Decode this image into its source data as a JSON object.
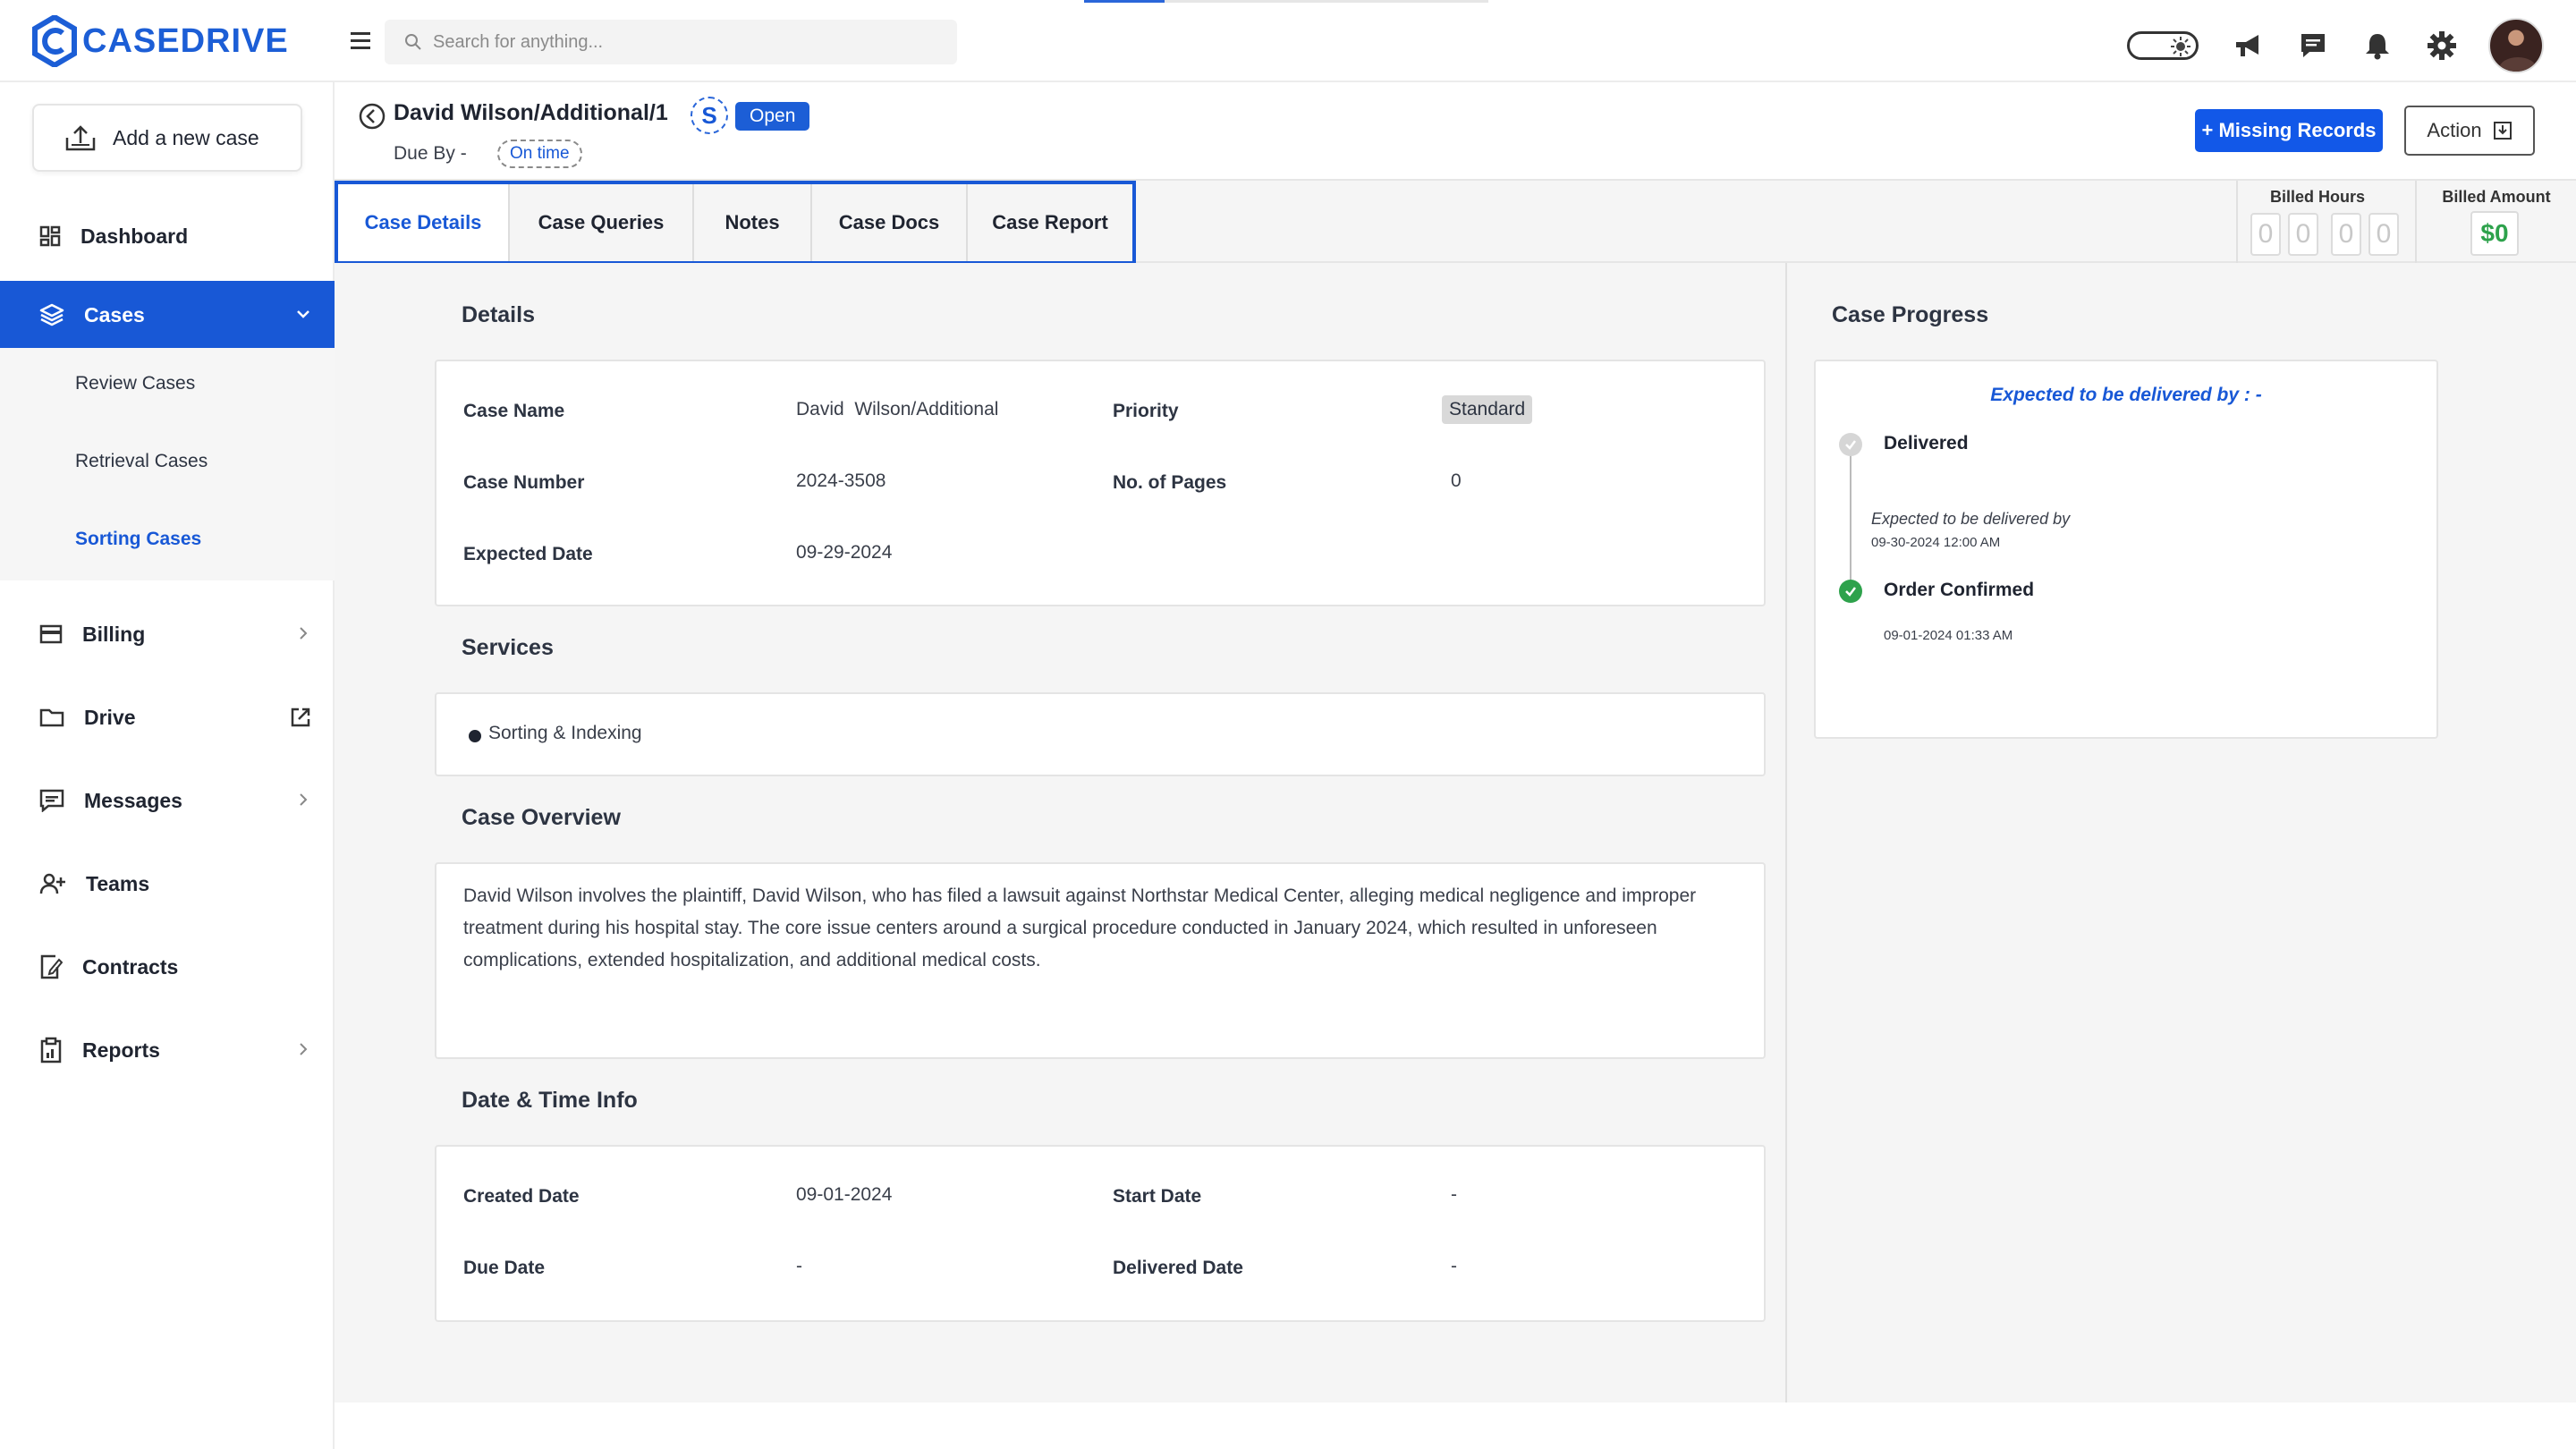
{
  "app": {
    "logo_text": "CASEDRIVE"
  },
  "search": {
    "placeholder": "Search for anything..."
  },
  "sidebar": {
    "add_case_label": "Add a new case",
    "items": [
      {
        "label": "Dashboard",
        "icon": "dashboard-icon"
      },
      {
        "label": "Cases",
        "icon": "layers-icon",
        "active": true
      },
      {
        "label": "Billing",
        "icon": "card-icon"
      },
      {
        "label": "Drive",
        "icon": "folder-icon"
      },
      {
        "label": "Messages",
        "icon": "message-icon"
      },
      {
        "label": "Teams",
        "icon": "users-icon"
      },
      {
        "label": "Contracts",
        "icon": "contract-icon"
      },
      {
        "label": "Reports",
        "icon": "report-icon"
      }
    ],
    "cases_sub": [
      "Review Cases",
      "Retrieval Cases",
      "Sorting Cases"
    ],
    "active_sub": "Sorting Cases"
  },
  "header": {
    "case_title": "David Wilson/Additional/1",
    "service_badge": "S",
    "status": "Open",
    "due_by_label": "Due By -",
    "due_status": "On time",
    "missing_records_label": "+ Missing Records",
    "action_label": "Action"
  },
  "tabs": [
    "Case Details",
    "Case Queries",
    "Notes",
    "Case Docs",
    "Case Report"
  ],
  "active_tab": "Case Details",
  "billing": {
    "hours_label": "Billed Hours",
    "hours_digits": [
      "0",
      "0",
      "0",
      "0"
    ],
    "amount_label": "Billed Amount",
    "amount": "$0"
  },
  "details": {
    "title": "Details",
    "case_name_label": "Case Name",
    "case_name": "David  Wilson/Additional",
    "priority_label": "Priority",
    "priority": "Standard",
    "case_number_label": "Case Number",
    "case_number": "2024-3508",
    "pages_label": "No. of Pages",
    "pages": "0",
    "expected_date_label": "Expected Date",
    "expected_date": "09-29-2024"
  },
  "services": {
    "title": "Services",
    "items": [
      "Sorting & Indexing"
    ]
  },
  "overview": {
    "title": "Case Overview",
    "text": "David Wilson involves the plaintiff, David Wilson, who has filed a lawsuit against Northstar Medical Center, alleging medical negligence and improper treatment during his hospital stay. The core issue centers around a surgical procedure conducted in January 2024, which resulted in unforeseen complications, extended hospitalization, and additional medical costs."
  },
  "datetime": {
    "title": "Date & Time Info",
    "created_label": "Created Date",
    "created": "09-01-2024",
    "start_label": "Start Date",
    "start": "-",
    "due_label": "Due Date",
    "due": "-",
    "delivered_label": "Delivered Date",
    "delivered": "-"
  },
  "progress": {
    "title": "Case Progress",
    "expected_header": "Expected to be delivered by : -",
    "steps": [
      {
        "label": "Delivered",
        "status": "pending",
        "note_label": "Expected to be delivered by",
        "note_time": "09-30-2024 12:00 AM"
      },
      {
        "label": "Order Confirmed",
        "status": "done",
        "time": "09-01-2024 01:33 AM"
      }
    ]
  },
  "colors": {
    "primary": "#1858d6",
    "success": "#2ea24c",
    "muted": "#f5f5f5"
  }
}
